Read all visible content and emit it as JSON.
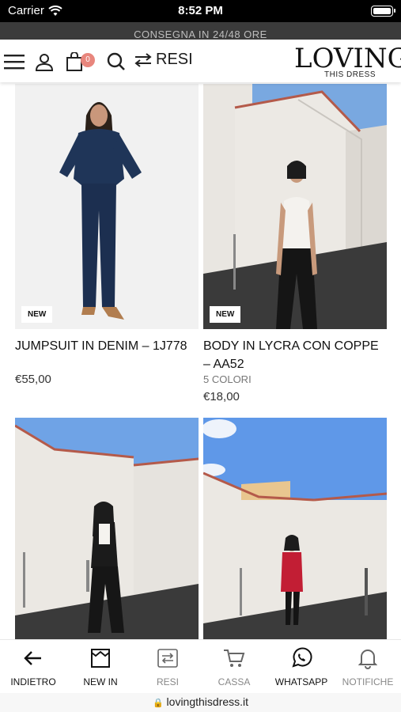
{
  "status": {
    "carrier": "Carrier",
    "time": "8:52 PM"
  },
  "promo": {
    "text": "CONSEGNA IN 24/48 ORE"
  },
  "header": {
    "menu_icon": "hamburger-icon",
    "account_icon": "user-icon",
    "cart_icon": "bag-icon",
    "cart_count": "0",
    "search_icon": "search-icon",
    "resi_label": "RESI",
    "logo_main": "LOVING",
    "logo_sub": "THIS DRESS"
  },
  "products": [
    {
      "title": "JUMPSUIT IN DENIM – 1J778",
      "subtitle": "",
      "price": "€55,00",
      "badge": "NEW"
    },
    {
      "title": "BODY IN LYCRA CON COPPE – AA52",
      "subtitle": "5 COLORI",
      "price": "€18,00",
      "badge": "NEW"
    },
    {
      "title": "",
      "subtitle": "",
      "price": "",
      "badge": ""
    },
    {
      "title": "",
      "subtitle": "",
      "price": "",
      "badge": ""
    }
  ],
  "tabs": [
    {
      "label": "INDIETRO",
      "icon": "arrow-left-icon"
    },
    {
      "label": "NEW IN",
      "icon": "image-frame-icon"
    },
    {
      "label": "RESI",
      "icon": "exchange-icon"
    },
    {
      "label": "CASSA",
      "icon": "cart-icon"
    },
    {
      "label": "WHATSAPP",
      "icon": "whatsapp-icon"
    },
    {
      "label": "NOTIFICHE",
      "icon": "bell-icon"
    }
  ],
  "url": {
    "domain": "lovingthisdress.it"
  },
  "colors": {
    "badge": "#e8867d",
    "promo_bg": "#3b3b3b",
    "sky": "#6fa3e6"
  }
}
